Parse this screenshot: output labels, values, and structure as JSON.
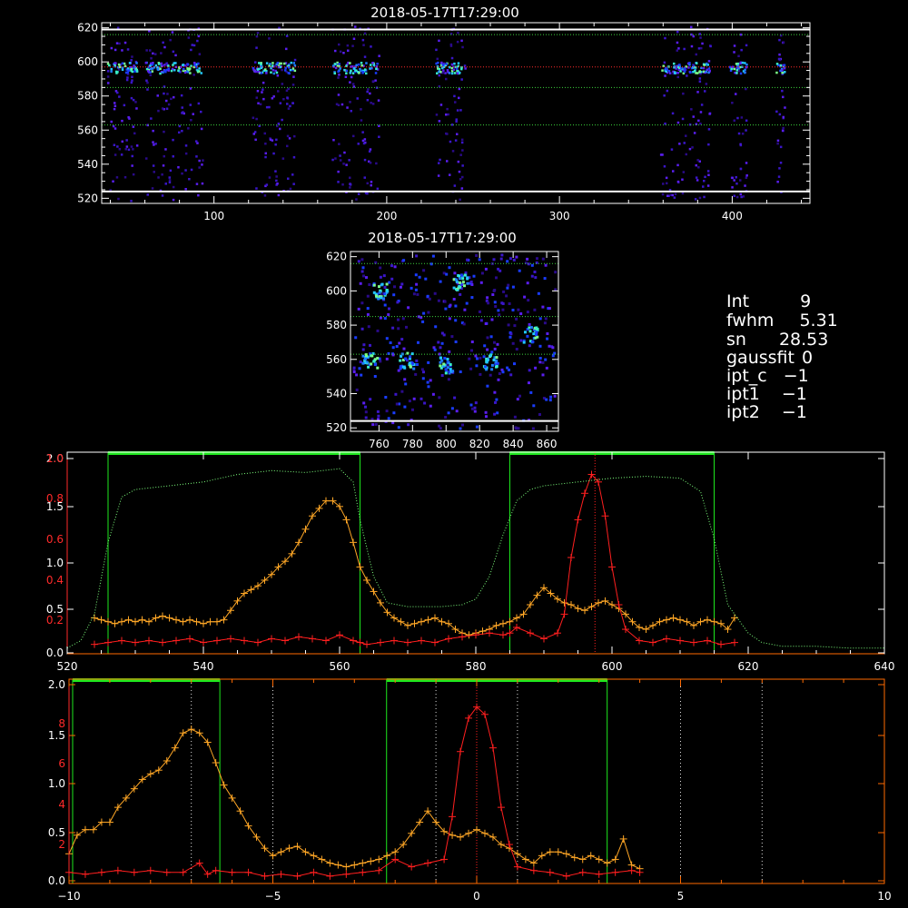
{
  "colors": {
    "background": "#000000",
    "axes": "#ffffff",
    "axis_lower": "#ff6a00",
    "axis_left_red": "#ff2a2a",
    "series_red": "#ff1f1f",
    "series_orange": "#ffa726",
    "window_green": "#1ee81e",
    "profile_green": "#7dff7d",
    "ref_line_red": "#ff2a2a",
    "ref_line_green": "#3cd23c",
    "bar_white": "#ffffff",
    "marker_white": "#dddddd"
  },
  "info": {
    "int_label": "Int",
    "int_value": "9",
    "fwhm_label": "fwhm",
    "fwhm_value": "5.31",
    "sn_label": "sn",
    "sn_value": "28.53",
    "gaussfit_label": "gaussfit",
    "gaussfit_value": "0",
    "ipt_c_label": "ipt_c",
    "ipt_c_value": "−1",
    "ipt1_label": "ipt1",
    "ipt1_value": "−1",
    "ipt2_label": "ipt2",
    "ipt2_value": "−1"
  },
  "chart_data": [
    {
      "type": "heatmap",
      "title": "2018-05-17T17:29:00",
      "xlim": [
        35,
        445
      ],
      "ylim": [
        517,
        623
      ],
      "xticks": [
        "100",
        "200",
        "300",
        "400"
      ],
      "yticks": [
        "520",
        "540",
        "560",
        "580",
        "600",
        "620"
      ],
      "hlines_green": [
        616,
        585,
        563
      ],
      "hline_red": 597,
      "hlines_white": [
        619,
        524
      ],
      "bands": [
        [
          38,
          55
        ],
        [
          60,
          93
        ],
        [
          122,
          147
        ],
        [
          168,
          195
        ],
        [
          228,
          245
        ],
        [
          358,
          387
        ],
        [
          398,
          408
        ],
        [
          425,
          430
        ]
      ],
      "hot_row": 597
    },
    {
      "type": "heatmap",
      "title": "2018-05-17T17:29:00",
      "xlim": [
        743,
        867
      ],
      "ylim": [
        518,
        623
      ],
      "xticks": [
        "760",
        "780",
        "800",
        "820",
        "840",
        "860"
      ],
      "yticks": [
        "520",
        "540",
        "560",
        "580",
        "600",
        "620"
      ],
      "hlines_green": [
        616,
        585,
        563
      ],
      "hline_white": 524,
      "hotspots": [
        [
          754,
          560
        ],
        [
          776,
          560
        ],
        [
          800,
          557
        ],
        [
          826,
          559
        ],
        [
          808,
          606
        ],
        [
          760,
          600
        ],
        [
          850,
          575
        ]
      ]
    },
    {
      "type": "line",
      "xlim": [
        520,
        640
      ],
      "xticks": [
        "520",
        "540",
        "560",
        "580",
        "600",
        "620",
        "640"
      ],
      "left_ticks_white": [
        "0.0",
        "0.5",
        "1.0",
        "1.5",
        "2.0"
      ],
      "left_ticks_red": [
        "0.2",
        "0.4",
        "0.6",
        "0.8",
        "1.0"
      ],
      "windows": [
        [
          526,
          563
        ],
        [
          585,
          615
        ]
      ],
      "vline_dotted": 597.5,
      "series": [
        {
          "color": "orange",
          "x": [
            524,
            525,
            526,
            527,
            528,
            529,
            530,
            531,
            532,
            533,
            534,
            535,
            536,
            537,
            538,
            539,
            540,
            541,
            542,
            543,
            544,
            545,
            546,
            547,
            548,
            549,
            550,
            551,
            552,
            553,
            554,
            555,
            556,
            557,
            558,
            559,
            560,
            561,
            562,
            563,
            564,
            565,
            566,
            567,
            568,
            569,
            570,
            571,
            572,
            573,
            574,
            575,
            576,
            577,
            578,
            579,
            580,
            581,
            582,
            583,
            584,
            585,
            586,
            587,
            588,
            589,
            590,
            591,
            592,
            593,
            594,
            595,
            596,
            597,
            598,
            599,
            600,
            601,
            602,
            603,
            604,
            605,
            606,
            607,
            608,
            609,
            610,
            611,
            612,
            613,
            614,
            615,
            616,
            617,
            618
          ],
          "y": [
            0.18,
            0.17,
            0.16,
            0.15,
            0.16,
            0.17,
            0.16,
            0.17,
            0.16,
            0.18,
            0.19,
            0.18,
            0.17,
            0.16,
            0.17,
            0.16,
            0.15,
            0.16,
            0.16,
            0.17,
            0.22,
            0.27,
            0.31,
            0.33,
            0.35,
            0.38,
            0.41,
            0.45,
            0.48,
            0.52,
            0.58,
            0.65,
            0.72,
            0.76,
            0.8,
            0.8,
            0.77,
            0.7,
            0.58,
            0.45,
            0.38,
            0.32,
            0.26,
            0.21,
            0.18,
            0.16,
            0.14,
            0.15,
            0.16,
            0.17,
            0.18,
            0.16,
            0.15,
            0.12,
            0.1,
            0.09,
            0.1,
            0.11,
            0.12,
            0.14,
            0.15,
            0.16,
            0.18,
            0.2,
            0.25,
            0.3,
            0.34,
            0.31,
            0.28,
            0.26,
            0.25,
            0.23,
            0.22,
            0.24,
            0.26,
            0.27,
            0.25,
            0.23,
            0.2,
            0.16,
            0.13,
            0.12,
            0.14,
            0.16,
            0.17,
            0.18,
            0.17,
            0.16,
            0.14,
            0.16,
            0.17,
            0.16,
            0.15,
            0.12,
            0.18
          ]
        },
        {
          "color": "red",
          "x": [
            524,
            526,
            528,
            530,
            532,
            534,
            536,
            538,
            540,
            542,
            544,
            546,
            548,
            550,
            552,
            554,
            556,
            558,
            560,
            562,
            563,
            564,
            566,
            568,
            570,
            572,
            574,
            576,
            578,
            580,
            582,
            584,
            585,
            586,
            588,
            590,
            592,
            593,
            594,
            595,
            596,
            597,
            598,
            599,
            600,
            601,
            602,
            604,
            606,
            608,
            610,
            612,
            614,
            616,
            618
          ],
          "y": [
            0.04,
            0.05,
            0.06,
            0.05,
            0.06,
            0.05,
            0.06,
            0.07,
            0.05,
            0.06,
            0.07,
            0.06,
            0.05,
            0.07,
            0.06,
            0.08,
            0.07,
            0.06,
            0.09,
            0.06,
            0.05,
            0.04,
            0.05,
            0.06,
            0.05,
            0.06,
            0.05,
            0.07,
            0.08,
            0.09,
            0.1,
            0.09,
            0.1,
            0.13,
            0.1,
            0.07,
            0.1,
            0.2,
            0.5,
            0.7,
            0.84,
            0.94,
            0.9,
            0.72,
            0.45,
            0.25,
            0.12,
            0.06,
            0.05,
            0.07,
            0.06,
            0.05,
            0.06,
            0.04,
            0.05
          ]
        },
        {
          "color": "green",
          "style": "dotted",
          "x": [
            520,
            522,
            524,
            526,
            528,
            530,
            535,
            540,
            545,
            550,
            555,
            560,
            562,
            563,
            565,
            567,
            570,
            575,
            578,
            580,
            582,
            584,
            586,
            588,
            590,
            595,
            600,
            605,
            610,
            613,
            615,
            617,
            620,
            622,
            625,
            630,
            635,
            640
          ],
          "y": [
            0.02,
            0.06,
            0.2,
            0.58,
            0.82,
            0.86,
            0.88,
            0.9,
            0.94,
            0.96,
            0.95,
            0.97,
            0.9,
            0.7,
            0.4,
            0.26,
            0.24,
            0.24,
            0.25,
            0.28,
            0.4,
            0.62,
            0.8,
            0.86,
            0.88,
            0.9,
            0.92,
            0.93,
            0.92,
            0.85,
            0.6,
            0.25,
            0.1,
            0.05,
            0.03,
            0.03,
            0.02,
            0.02
          ]
        }
      ]
    },
    {
      "type": "line",
      "xlim": [
        -10,
        10
      ],
      "xticks": [
        "−10",
        "−5",
        "0",
        "5",
        "10"
      ],
      "left_ticks_white": [
        "0.0",
        "0.5",
        "1.0",
        "1.5",
        "2.0"
      ],
      "left_ticks_red": [
        "2",
        "4",
        "6",
        "8"
      ],
      "windows": [
        [
          -10,
          -6.3
        ],
        [
          -2.3,
          3.2
        ]
      ],
      "vlines_dotted": [
        -7,
        -5,
        -1,
        1,
        5,
        7
      ],
      "vline_center": 0,
      "series": [
        {
          "color": "orange",
          "x": [
            -10,
            -9.8,
            -9.6,
            -9.4,
            -9.2,
            -9,
            -8.8,
            -8.6,
            -8.4,
            -8.2,
            -8,
            -7.8,
            -7.6,
            -7.4,
            -7.2,
            -7,
            -6.8,
            -6.6,
            -6.4,
            -6.2,
            -6,
            -5.8,
            -5.6,
            -5.4,
            -5.2,
            -5,
            -4.8,
            -4.6,
            -4.4,
            -4.2,
            -4,
            -3.8,
            -3.6,
            -3.4,
            -3.2,
            -3,
            -2.8,
            -2.6,
            -2.4,
            -2.2,
            -2,
            -1.8,
            -1.6,
            -1.4,
            -1.2,
            -1,
            -0.8,
            -0.6,
            -0.4,
            -0.2,
            0,
            0.2,
            0.4,
            0.6,
            0.8,
            1,
            1.2,
            1.4,
            1.6,
            1.8,
            2,
            2.2,
            2.4,
            2.6,
            2.8,
            3,
            3.2,
            3.4,
            3.6,
            3.8,
            4
          ],
          "y": [
            0.15,
            0.25,
            0.28,
            0.28,
            0.32,
            0.32,
            0.4,
            0.45,
            0.5,
            0.55,
            0.58,
            0.6,
            0.65,
            0.72,
            0.8,
            0.82,
            0.8,
            0.75,
            0.64,
            0.52,
            0.45,
            0.38,
            0.3,
            0.24,
            0.18,
            0.14,
            0.16,
            0.18,
            0.19,
            0.16,
            0.14,
            0.12,
            0.1,
            0.09,
            0.08,
            0.09,
            0.1,
            0.11,
            0.12,
            0.14,
            0.16,
            0.2,
            0.26,
            0.32,
            0.38,
            0.32,
            0.27,
            0.25,
            0.24,
            0.26,
            0.28,
            0.26,
            0.24,
            0.2,
            0.18,
            0.15,
            0.12,
            0.1,
            0.14,
            0.16,
            0.16,
            0.15,
            0.13,
            0.12,
            0.14,
            0.12,
            0.1,
            0.12,
            0.23,
            0.09,
            0.07
          ]
        },
        {
          "color": "red",
          "x": [
            -10,
            -9.6,
            -9.2,
            -8.8,
            -8.4,
            -8,
            -7.6,
            -7.2,
            -6.8,
            -6.6,
            -6.4,
            -6,
            -5.6,
            -5.2,
            -4.8,
            -4.4,
            -4,
            -3.6,
            -3.2,
            -2.8,
            -2.4,
            -2,
            -1.6,
            -1.2,
            -0.8,
            -0.6,
            -0.4,
            -0.2,
            0,
            0.2,
            0.4,
            0.6,
            0.8,
            1,
            1.4,
            1.8,
            2.2,
            2.6,
            3,
            3.4,
            3.8,
            4
          ],
          "y": [
            0.05,
            0.04,
            0.05,
            0.06,
            0.05,
            0.06,
            0.05,
            0.05,
            0.1,
            0.04,
            0.06,
            0.05,
            0.05,
            0.03,
            0.04,
            0.03,
            0.05,
            0.03,
            0.04,
            0.05,
            0.06,
            0.12,
            0.08,
            0.1,
            0.12,
            0.35,
            0.7,
            0.88,
            0.94,
            0.9,
            0.72,
            0.4,
            0.2,
            0.08,
            0.06,
            0.05,
            0.03,
            0.05,
            0.04,
            0.05,
            0.06,
            0.05
          ]
        }
      ]
    }
  ]
}
